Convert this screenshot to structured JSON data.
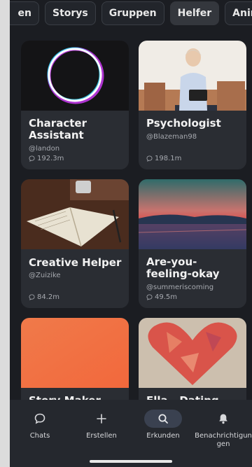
{
  "tabs": [
    {
      "label": "en",
      "active": false
    },
    {
      "label": "Storys",
      "active": false
    },
    {
      "label": "Gruppen",
      "active": false
    },
    {
      "label": "Helfer",
      "active": true
    },
    {
      "label": "Anime-Sp",
      "active": false
    }
  ],
  "cards": [
    {
      "title": "Character Assistant",
      "author": "@landon",
      "count": "192.3m"
    },
    {
      "title": "Psychologist",
      "author": "@Blazeman98",
      "count": "198.1m"
    },
    {
      "title": "Creative Helper",
      "author": "@Zuizike",
      "count": "84.2m"
    },
    {
      "title": "Are-you-feeling-okay",
      "author": "@summeriscoming",
      "count": "49.5m"
    },
    {
      "title": "Story Maker",
      "author": "",
      "count": ""
    },
    {
      "title": "Ella - Dating",
      "author": "",
      "count": ""
    }
  ],
  "nav": {
    "chats": "Chats",
    "create": "Erstellen",
    "explore": "Erkunden",
    "notifications": "Benachrichtigungen"
  },
  "colors": {
    "background": "#1b1d22",
    "card": "#2a2d33",
    "active_tab": "#34373d",
    "nav_active": "#3a4150"
  }
}
